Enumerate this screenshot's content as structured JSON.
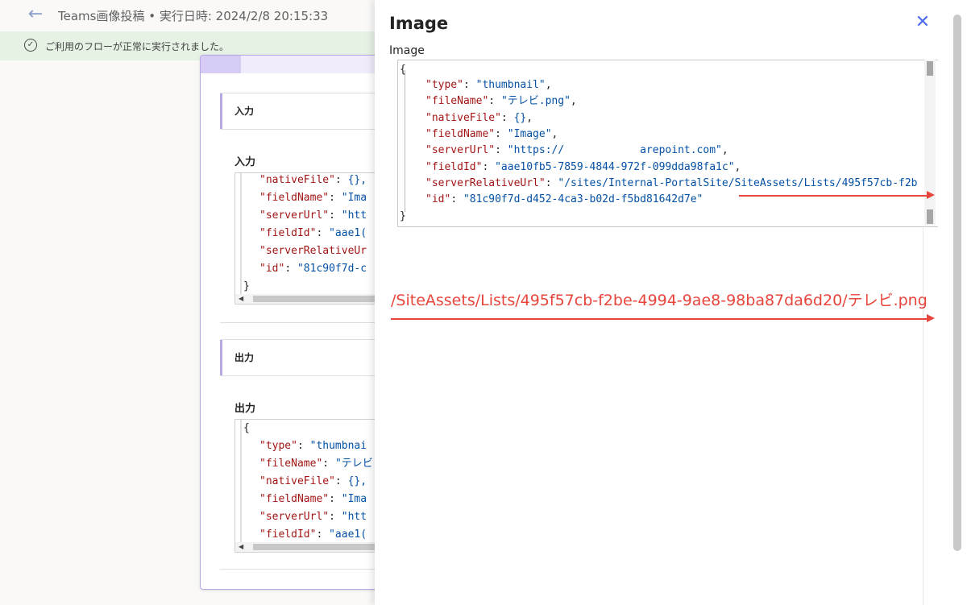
{
  "header": {
    "back_label": "←",
    "title": "Teams画像投稿 • 実行日時: 2024/2/8 20:15:33"
  },
  "banner": {
    "icon_glyph": "✓",
    "message": "ご利用のフローが正常に実行されました。"
  },
  "card": {
    "input_section": {
      "heading": "入力",
      "label": "入力",
      "lines": [
        {
          "key": "\"nativeFile\"",
          "sep": ": ",
          "val": "{},"
        },
        {
          "key": "\"fieldName\"",
          "sep": ": ",
          "val": "\"Ima"
        },
        {
          "key": "\"serverUrl\"",
          "sep": ": ",
          "val": "\"htt"
        },
        {
          "key": "\"fieldId\"",
          "sep": ": ",
          "val": "\"aae1("
        },
        {
          "key": "\"serverRelativeUr",
          "sep": "",
          "val": ""
        },
        {
          "key": "\"id\"",
          "sep": ": ",
          "val": "\"81c90f7d-c"
        },
        {
          "key": "",
          "sep": "}",
          "val": ""
        }
      ]
    },
    "output_section": {
      "heading": "出力",
      "label": "出力",
      "lines": [
        {
          "key": "",
          "sep": "{",
          "val": ""
        },
        {
          "key": "\"type\"",
          "sep": ": ",
          "val": "\"thumbnai"
        },
        {
          "key": "\"fileName\"",
          "sep": ": ",
          "val": "\"テレビ"
        },
        {
          "key": "\"nativeFile\"",
          "sep": ": ",
          "val": "{},"
        },
        {
          "key": "\"fieldName\"",
          "sep": ": ",
          "val": "\"Ima"
        },
        {
          "key": "\"serverUrl\"",
          "sep": ": ",
          "val": "\"htt"
        },
        {
          "key": "\"fieldId\"",
          "sep": ": ",
          "val": "\"aae1("
        }
      ]
    }
  },
  "panel": {
    "title": "Image",
    "close_glyph": "✕",
    "field_label": "Image",
    "json_open": "{",
    "json_close": "}",
    "json_lines": [
      {
        "key": "\"type\"",
        "sep": ": ",
        "val": "\"thumbnail\"",
        "tail": ","
      },
      {
        "key": "\"fileName\"",
        "sep": ": ",
        "val": "\"テレビ.png\"",
        "tail": ","
      },
      {
        "key": "\"nativeFile\"",
        "sep": ": ",
        "val": "{}",
        "tail": ","
      },
      {
        "key": "\"fieldName\"",
        "sep": ": ",
        "val": "\"Image\"",
        "tail": ","
      },
      {
        "key": "\"serverUrl\"",
        "sep": ": ",
        "val": "\"https://            arepoint.com\"",
        "tail": ","
      },
      {
        "key": "\"fieldId\"",
        "sep": ": ",
        "val": "\"aae10fb5-7859-4844-972f-099dda98fa1c\"",
        "tail": ","
      },
      {
        "key": "\"serverRelativeUrl\"",
        "sep": ": ",
        "val": "\"/sites/Internal-PortalSite/SiteAssets/Lists/495f57cb-f2b",
        "tail": ""
      },
      {
        "key": "\"id\"",
        "sep": ": ",
        "val": "\"81c90f7d-d452-4ca3-b02d-f5bd81642d7e\"",
        "tail": ""
      }
    ],
    "annotation": "/SiteAssets/Lists/495f57cb-f2be-4994-9ae8-98ba87da6d20/テレビ.png",
    "colors": {
      "annotation": "#e8453c",
      "key": "#a31515",
      "string": "#0451a5"
    }
  }
}
